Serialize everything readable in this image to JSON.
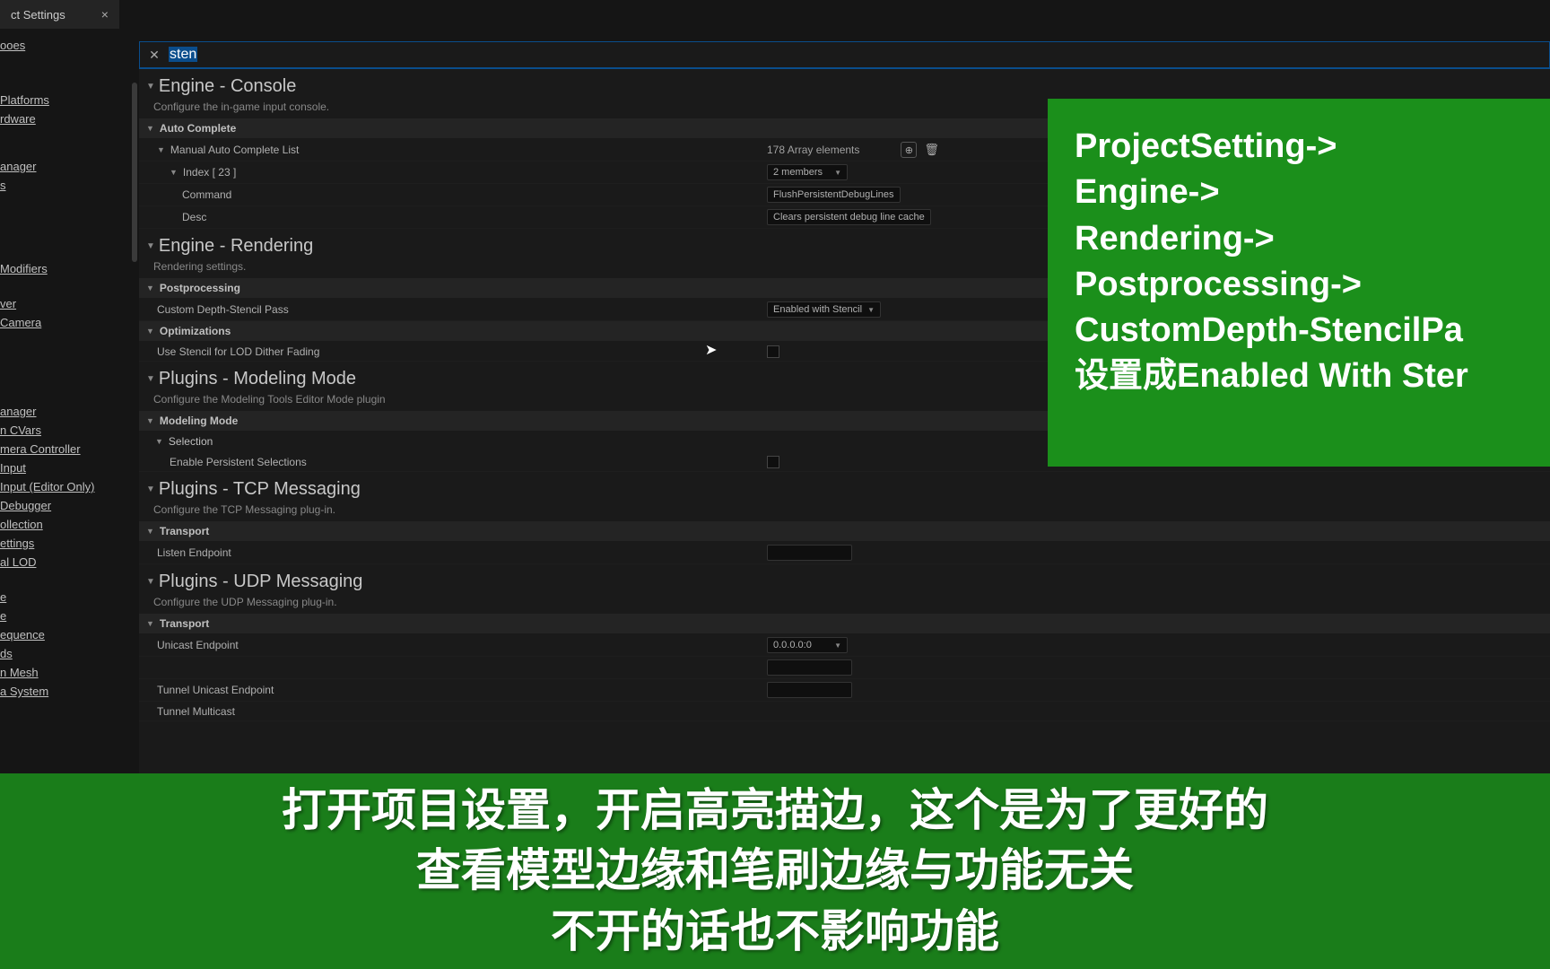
{
  "tab": {
    "title": "ct Settings"
  },
  "search": {
    "value": "sten"
  },
  "sidebar": {
    "items": [
      "ooes",
      "",
      "Platforms",
      "rdware",
      "",
      "",
      "anager",
      "s",
      "",
      "",
      "",
      "Modifiers",
      "",
      "ver",
      "Camera",
      "",
      "",
      "",
      "",
      "anager",
      "n CVars",
      "mera Controller",
      "Input",
      "Input (Editor Only)",
      "Debugger",
      "ollection",
      "ettings",
      "al LOD",
      "",
      "e",
      "e",
      "equence",
      "ds",
      "n Mesh",
      "a System"
    ]
  },
  "sec_console": {
    "title": "Engine - Console",
    "desc": "Configure the in-game input console.",
    "cat_auto": "Auto Complete",
    "cat_manual": "Manual Auto Complete List",
    "array_count": "178 Array elements",
    "index_label": "Index [ 23 ]",
    "members": "2 members",
    "command_label": "Command",
    "command_value": "FlushPersistentDebugLines",
    "desc_label": "Desc",
    "desc_value": "Clears persistent debug line cache"
  },
  "sec_rendering": {
    "title": "Engine - Rendering",
    "desc": "Rendering settings.",
    "cat_post": "Postprocessing",
    "depth_label": "Custom Depth-Stencil Pass",
    "depth_value": "Enabled with Stencil",
    "cat_opt": "Optimizations",
    "stencil_fade": "Use Stencil for LOD Dither Fading"
  },
  "sec_modeling": {
    "title": "Plugins - Modeling Mode",
    "desc": "Configure the Modeling Tools Editor Mode plugin",
    "cat_mode": "Modeling Mode",
    "cat_sel": "Selection",
    "persist_sel": "Enable Persistent Selections"
  },
  "sec_tcp": {
    "title": "Plugins - TCP Messaging",
    "desc": "Configure the TCP Messaging plug-in.",
    "cat_transport": "Transport",
    "listen": "Listen Endpoint"
  },
  "sec_udp": {
    "title": "Plugins - UDP Messaging",
    "desc": "Configure the UDP Messaging plug-in.",
    "cat_transport": "Transport",
    "unicast": "Unicast Endpoint",
    "unicast_value": "0.0.0.0:0",
    "row2": "",
    "tunnel_uni": "Tunnel Unicast Endpoint",
    "tunnel_multi": "Tunnel Multicast"
  },
  "overlay_right": {
    "l1": "ProjectSetting->",
    "l2": "Engine->",
    "l3": "Rendering->",
    "l4": "Postprocessing->",
    "l5": "CustomDepth-StencilPa",
    "l6": "设置成Enabled With Ster"
  },
  "overlay_bottom": {
    "l1": "打开项目设置，开启高亮描边，这个是为了更好的",
    "l2": "查看模型边缘和笔刷边缘与功能无关",
    "l3": "不开的话也不影响功能"
  }
}
